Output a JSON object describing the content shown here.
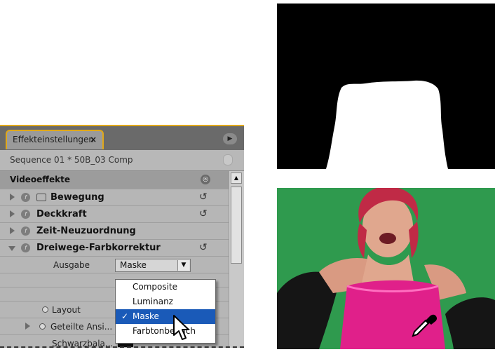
{
  "panel": {
    "tab_label": "Effekteinstellungen",
    "tab_close": "×",
    "sequence": "Sequence 01 * 50B_03 Comp",
    "section_label": "Videoeffekte",
    "effects": [
      {
        "name": "Bewegung"
      },
      {
        "name": "Deckkraft"
      },
      {
        "name": "Zeit-Neuzuordnung"
      },
      {
        "name": "Dreiwege-Farbkorrektur"
      }
    ],
    "params": {
      "ausgabe_label": "Ausgabe",
      "ausgabe_value": "Maske",
      "layout_label": "Layout",
      "geteilte_label": "Geteilte Ansi...",
      "schwarz_label": "Schwarzbala..."
    }
  },
  "dropdown": {
    "options": [
      "Composite",
      "Luminanz",
      "Maske",
      "Farbtonbereich"
    ],
    "selected_index": 2,
    "check": "✓"
  },
  "icons": {
    "reset": "reset-icon",
    "fx": "fx-icon",
    "eyedropper": "eyedropper-icon"
  },
  "colors": {
    "accent": "#e0a81a",
    "selection": "#1a5ab8",
    "green_screen": "#2f9a4e",
    "dress": "#e0208a"
  }
}
